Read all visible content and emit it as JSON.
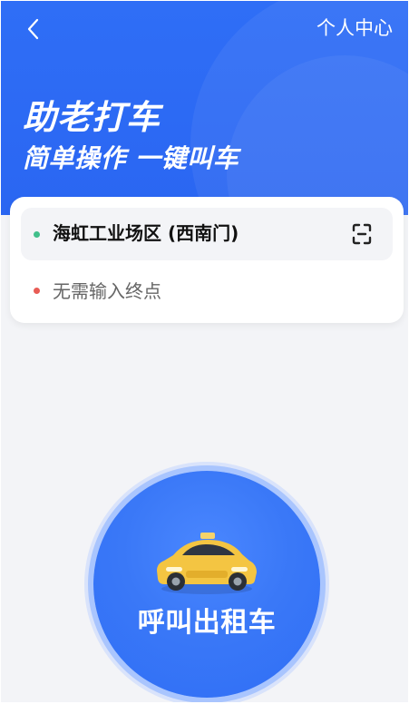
{
  "header": {
    "profile_label": "个人中心",
    "title": "助老打车",
    "subtitle": "简单操作 一键叫车"
  },
  "route": {
    "origin": "海虹工业场区 (西南门)",
    "destination_placeholder": "无需输入终点"
  },
  "action": {
    "call_label": "呼叫出租车"
  },
  "icons": {
    "back": "chevron-left-icon",
    "scan": "scan-icon",
    "car": "taxi-icon"
  },
  "colors": {
    "hero_blue": "#2f6ef6",
    "origin_dot": "#41bf8b",
    "destination_dot": "#e85c55",
    "taxi_yellow": "#f4c542"
  }
}
